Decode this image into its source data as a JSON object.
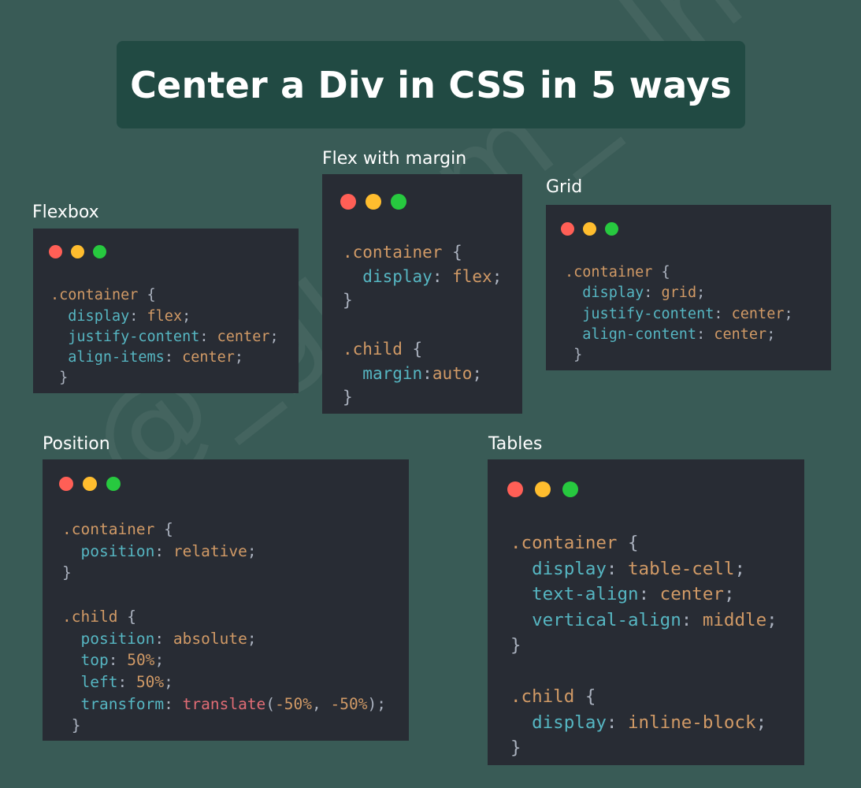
{
  "title": "Center a Div in CSS in 5 ways",
  "colors": {
    "background": "#395b56",
    "title_box": "#214a43",
    "panel": "#282c34",
    "dot_red": "#ff5f56",
    "dot_yellow": "#ffbd2e",
    "dot_green": "#27c93f",
    "selector": "#d19a66",
    "property": "#56b6c2",
    "value": "#d19a66",
    "function": "#e06c75",
    "punctuation": "#abb2bf"
  },
  "panels": [
    {
      "id": "flexbox",
      "label": "Flexbox",
      "lines": [
        [],
        [
          [
            "sel",
            ".container"
          ],
          [
            "p",
            " {"
          ]
        ],
        [
          [
            "p",
            "  "
          ],
          [
            "prop",
            "display"
          ],
          [
            "p",
            ": "
          ],
          [
            "val",
            "flex"
          ],
          [
            "p",
            ";"
          ]
        ],
        [
          [
            "p",
            "  "
          ],
          [
            "prop",
            "justify-content"
          ],
          [
            "p",
            ": "
          ],
          [
            "val",
            "center"
          ],
          [
            "p",
            ";"
          ]
        ],
        [
          [
            "p",
            "  "
          ],
          [
            "prop",
            "align-items"
          ],
          [
            "p",
            ": "
          ],
          [
            "val",
            "center"
          ],
          [
            "p",
            ";"
          ]
        ],
        [
          [
            "p",
            " }"
          ]
        ]
      ]
    },
    {
      "id": "flex-margin",
      "label": "Flex with margin",
      "lines": [
        [
          [
            "sel",
            ".container"
          ],
          [
            "p",
            " {"
          ]
        ],
        [
          [
            "p",
            "  "
          ],
          [
            "prop",
            "display"
          ],
          [
            "p",
            ": "
          ],
          [
            "val",
            "flex"
          ],
          [
            "p",
            ";"
          ]
        ],
        [
          [
            "p",
            "}"
          ]
        ],
        [],
        [
          [
            "sel",
            ".child"
          ],
          [
            "p",
            " {"
          ]
        ],
        [
          [
            "p",
            "  "
          ],
          [
            "prop",
            "margin"
          ],
          [
            "p",
            ":"
          ],
          [
            "val",
            "auto"
          ],
          [
            "p",
            ";"
          ]
        ],
        [
          [
            "p",
            "}"
          ]
        ]
      ]
    },
    {
      "id": "grid",
      "label": "Grid",
      "lines": [
        [
          [
            "sel",
            ".container"
          ],
          [
            "p",
            " {"
          ]
        ],
        [
          [
            "p",
            "  "
          ],
          [
            "prop",
            "display"
          ],
          [
            "p",
            ": "
          ],
          [
            "val",
            "grid"
          ],
          [
            "p",
            ";"
          ]
        ],
        [
          [
            "p",
            "  "
          ],
          [
            "prop",
            "justify-content"
          ],
          [
            "p",
            ": "
          ],
          [
            "val",
            "center"
          ],
          [
            "p",
            ";"
          ]
        ],
        [
          [
            "p",
            "  "
          ],
          [
            "prop",
            "align-content"
          ],
          [
            "p",
            ": "
          ],
          [
            "val",
            "center"
          ],
          [
            "p",
            ";"
          ]
        ],
        [
          [
            "p",
            " }"
          ]
        ]
      ]
    },
    {
      "id": "position",
      "label": "Position",
      "lines": [
        [
          [
            "sel",
            ".container"
          ],
          [
            "p",
            " {"
          ]
        ],
        [
          [
            "p",
            "  "
          ],
          [
            "prop",
            "position"
          ],
          [
            "p",
            ": "
          ],
          [
            "val",
            "relative"
          ],
          [
            "p",
            ";"
          ]
        ],
        [
          [
            "p",
            "}"
          ]
        ],
        [],
        [
          [
            "sel",
            ".child"
          ],
          [
            "p",
            " {"
          ]
        ],
        [
          [
            "p",
            "  "
          ],
          [
            "prop",
            "position"
          ],
          [
            "p",
            ": "
          ],
          [
            "val",
            "absolute"
          ],
          [
            "p",
            ";"
          ]
        ],
        [
          [
            "p",
            "  "
          ],
          [
            "prop",
            "top"
          ],
          [
            "p",
            ": "
          ],
          [
            "val",
            "50%"
          ],
          [
            "p",
            ";"
          ]
        ],
        [
          [
            "p",
            "  "
          ],
          [
            "prop",
            "left"
          ],
          [
            "p",
            ": "
          ],
          [
            "val",
            "50%"
          ],
          [
            "p",
            ";"
          ]
        ],
        [
          [
            "p",
            "  "
          ],
          [
            "prop",
            "transform"
          ],
          [
            "p",
            ": "
          ],
          [
            "fn",
            "translate"
          ],
          [
            "p",
            "("
          ],
          [
            "val",
            "-50%"
          ],
          [
            "p",
            ", "
          ],
          [
            "val",
            "-50%"
          ],
          [
            "p",
            ");"
          ]
        ],
        [
          [
            "p",
            " }"
          ]
        ]
      ]
    },
    {
      "id": "tables",
      "label": "Tables",
      "lines": [
        [
          [
            "sel",
            ".container"
          ],
          [
            "p",
            " {"
          ]
        ],
        [
          [
            "p",
            "  "
          ],
          [
            "prop",
            "display"
          ],
          [
            "p",
            ": "
          ],
          [
            "val",
            "table-cell"
          ],
          [
            "p",
            ";"
          ]
        ],
        [
          [
            "p",
            "  "
          ],
          [
            "prop",
            "text-align"
          ],
          [
            "p",
            ": "
          ],
          [
            "val",
            "center"
          ],
          [
            "p",
            ";"
          ]
        ],
        [
          [
            "p",
            "  "
          ],
          [
            "prop",
            "vertical-align"
          ],
          [
            "p",
            ": "
          ],
          [
            "val",
            "middle"
          ],
          [
            "p",
            ";"
          ]
        ],
        [
          [
            "p",
            "}"
          ]
        ],
        [],
        [
          [
            "sel",
            ".child"
          ],
          [
            "p",
            " {"
          ]
        ],
        [
          [
            "p",
            "  "
          ],
          [
            "prop",
            "display"
          ],
          [
            "p",
            ": "
          ],
          [
            "val",
            "inline-block"
          ],
          [
            "p",
            ";"
          ]
        ],
        [
          [
            "p",
            "}"
          ]
        ]
      ]
    }
  ],
  "watermark": "@_gulam_alnas_"
}
